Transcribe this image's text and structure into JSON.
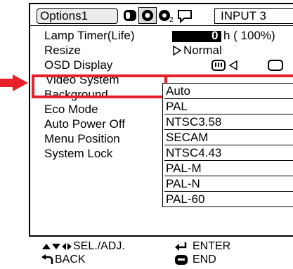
{
  "tabs": {
    "options_label": "Options1",
    "input_label": "INPUT 3"
  },
  "menu": {
    "items": [
      "Lamp Timer(Life)",
      "Resize",
      "OSD Display",
      "Video System",
      "Background",
      "Eco Mode",
      "Auto Power Off",
      "Menu Position",
      "System Lock"
    ],
    "lamp_hours": "0",
    "lamp_unit": "h ( 100%)",
    "resize_value": "Normal"
  },
  "video_system_options": [
    "Auto",
    "PAL",
    "NTSC3.58",
    "SECAM",
    "NTSC4.43",
    "PAL-M",
    "PAL-N",
    "PAL-60"
  ],
  "hints": {
    "sel_adj": "SEL./ADJ.",
    "enter": "ENTER",
    "back": "BACK",
    "end": "END"
  },
  "colors": {
    "highlight": "#e8202a"
  }
}
